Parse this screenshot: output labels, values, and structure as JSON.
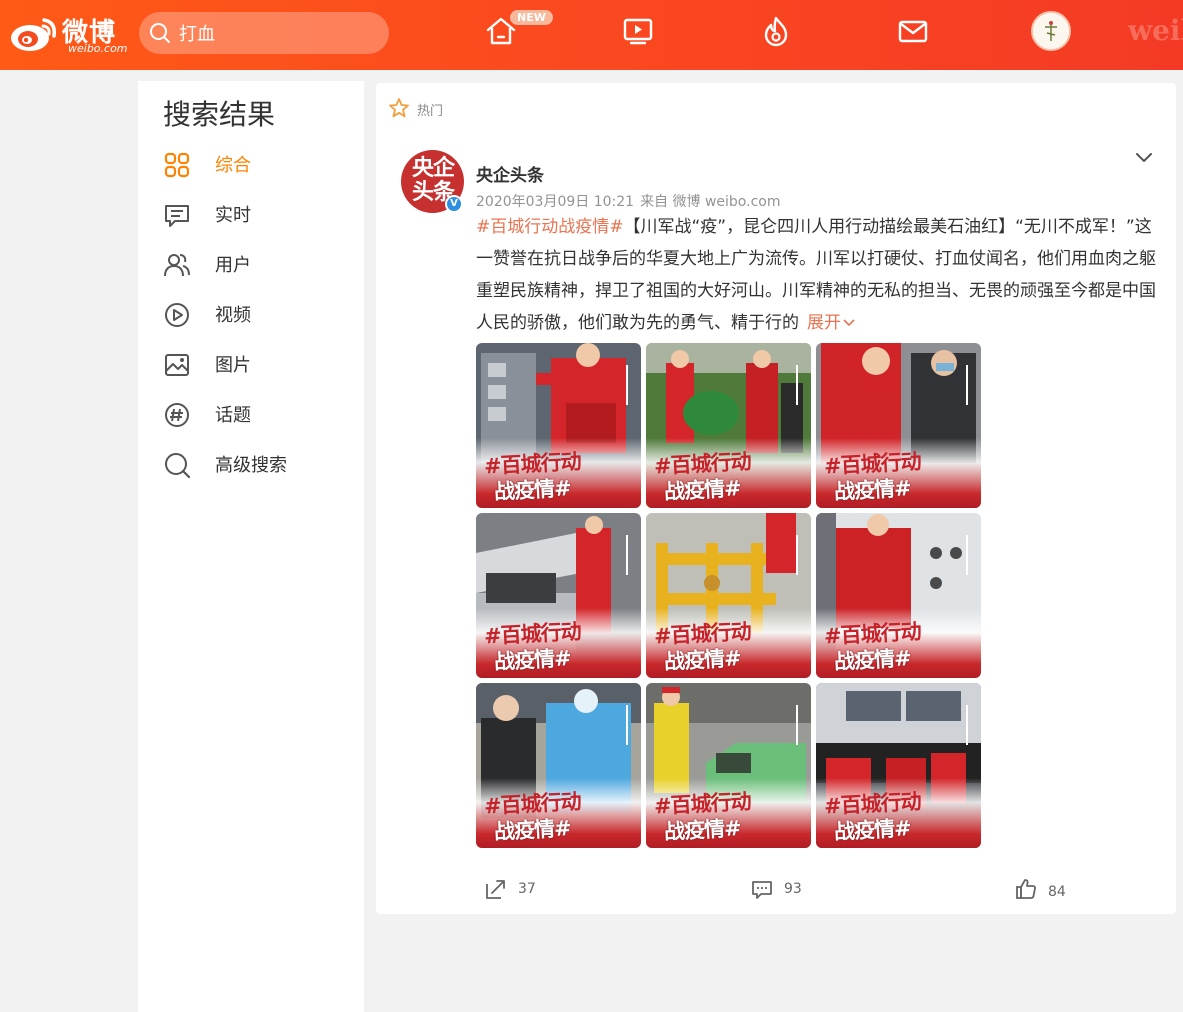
{
  "header": {
    "logo_text": "微博",
    "logo_sub": "weibo.com",
    "search_value": "打血",
    "new_badge": "NEW",
    "watermark": "weib",
    "nav_icons": [
      "home-icon",
      "video-icon",
      "hot-icon",
      "mail-icon"
    ],
    "accent": "#ff5a16"
  },
  "sidebar": {
    "title": "搜索结果",
    "items": [
      {
        "label": "综合",
        "icon": "grid-icon",
        "active": true
      },
      {
        "label": "实时",
        "icon": "message-icon"
      },
      {
        "label": "用户",
        "icon": "users-icon"
      },
      {
        "label": "视频",
        "icon": "play-icon"
      },
      {
        "label": "图片",
        "icon": "image-icon"
      },
      {
        "label": "话题",
        "icon": "hashtag-icon"
      },
      {
        "label": "高级搜索",
        "icon": "search-icon"
      }
    ],
    "active_color": "#ff8200"
  },
  "post": {
    "section_label": "热门",
    "author_name": "央企头条",
    "avatar_text": "央企头条",
    "timestamp": "2020年03月09日 10:21",
    "source": "来自 微博 weibo.com",
    "hashtag": "#百城行动战疫情#",
    "text": "【川军战“疫”，昆仑四川人用行动描绘最美石油红】“无川不成军！”这一赞誉在抗日战争后的华夏大地上广为流传。川军以打硬仗、打血仗闻名，他们用血肉之躯重塑民族精神，捍卫了祖国的大好河山。川军精神的无私的担当、无畏的顽强至今都是中国人民的骄傲，他们敢为先的勇气、精于行的",
    "expand_label": "展开",
    "image_caption_line1": "#百城行动",
    "image_caption_line2": "战疫情#",
    "images": [
      {
        "name": "gas-station-worker"
      },
      {
        "name": "field-workers"
      },
      {
        "name": "mask-distribution"
      },
      {
        "name": "car-engine-check"
      },
      {
        "name": "yellow-pipes"
      },
      {
        "name": "temperature-wall"
      },
      {
        "name": "temperature-check"
      },
      {
        "name": "car-disinfection"
      },
      {
        "name": "control-room"
      }
    ],
    "actions": {
      "repost_count": "37",
      "comment_count": "93",
      "like_count": "84"
    },
    "tag_color": "#eb7350"
  }
}
